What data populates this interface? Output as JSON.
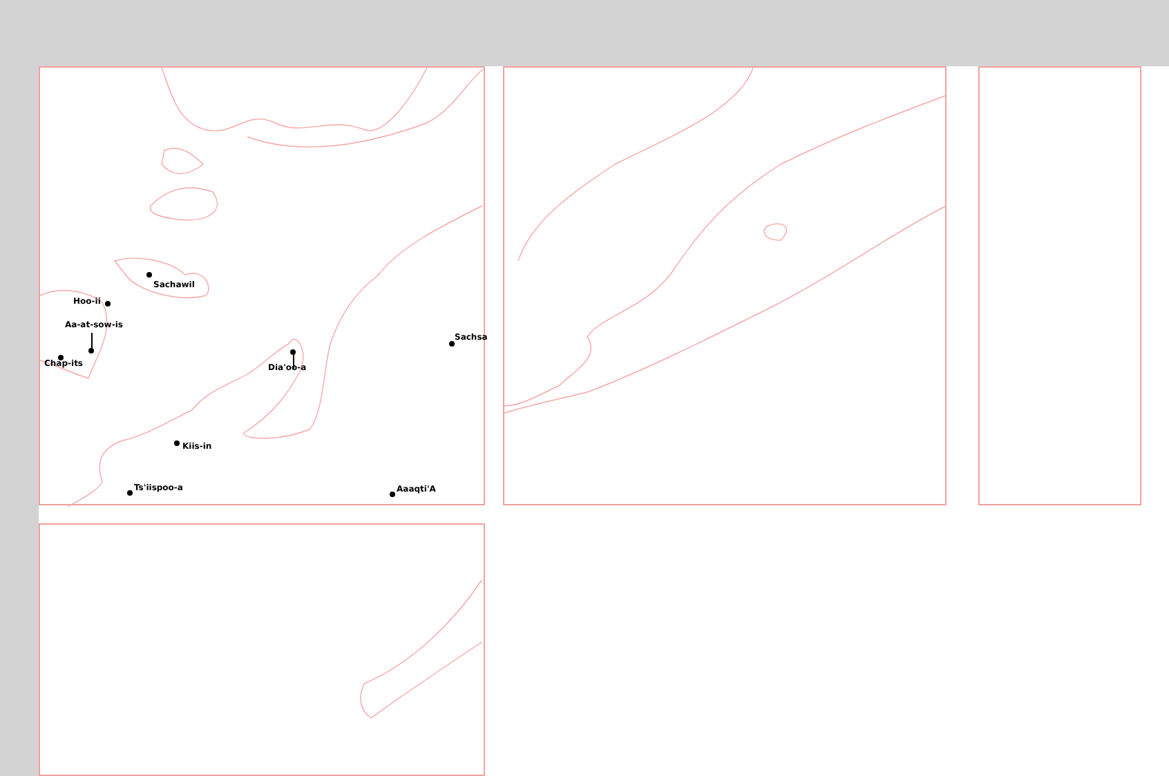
{
  "map_sheet": {
    "places": [
      {
        "name": "Sachawil"
      },
      {
        "name": "Hoo-ii"
      },
      {
        "name": "Aa-at-sow-is"
      },
      {
        "name": "Chap-its"
      },
      {
        "name": "Dia'oo-a"
      },
      {
        "name": "Sachsa"
      },
      {
        "name": "Kiis-in"
      },
      {
        "name": "Ts'iispoo-a"
      },
      {
        "name": "Aaaqti'A"
      }
    ]
  }
}
